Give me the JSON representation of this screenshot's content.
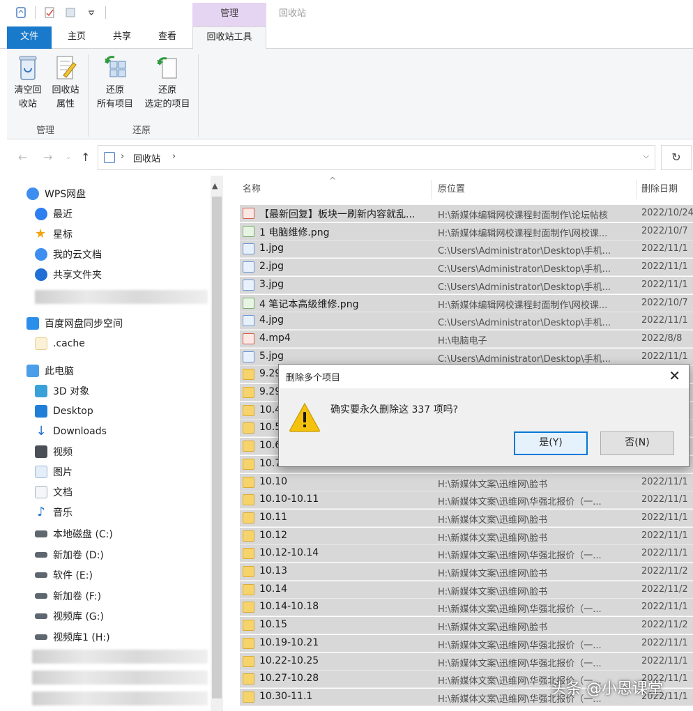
{
  "window": {
    "context_group_label": "管理",
    "title": "回收站"
  },
  "tabs": {
    "file": "文件",
    "home": "主页",
    "share": "共享",
    "view": "查看",
    "recycle_tools": "回收站工具"
  },
  "ribbon": {
    "empty_bin": "清空回\n收站",
    "bin_props": "回收站\n属性",
    "restore_all": "还原\n所有项目",
    "restore_selected": "还原\n选定的项目",
    "group_manage": "管理",
    "group_restore": "还原"
  },
  "address": {
    "location": "回收站"
  },
  "nav": {
    "wps": "WPS网盘",
    "recent": "最近",
    "starred": "星标",
    "my_cloud": "我的云文档",
    "shared": "共享文件夹",
    "baidu": "百度网盘同步空间",
    "cache": ".cache",
    "this_pc": "此电脑",
    "objects3d": "3D 对象",
    "desktop": "Desktop",
    "downloads": "Downloads",
    "videos": "视频",
    "pictures": "图片",
    "documents": "文档",
    "music": "音乐",
    "drive_c": "本地磁盘 (C:)",
    "drive_d": "新加卷 (D:)",
    "drive_e": "软件 (E:)",
    "drive_f": "新加卷 (F:)",
    "drive_g": "视频库 (G:)",
    "drive_h": "视频库1 (H:)"
  },
  "columns": {
    "name": "名称",
    "location": "原位置",
    "date": "删除日期"
  },
  "files": [
    {
      "name": "【最新回复】板块一刷新内容就乱...",
      "loc": "H:\\新媒体编辑网校课程封面制作\\论坛帖核",
      "date": "2022/10/24",
      "icon": "red"
    },
    {
      "name": "1 电脑维修.png",
      "loc": "H:\\新媒体编辑网校课程封面制作\\网校课...",
      "date": "2022/10/7",
      "icon": "imgg"
    },
    {
      "name": "1.jpg",
      "loc": "C:\\Users\\Administrator\\Desktop\\手机...",
      "date": "2022/11/1",
      "icon": "imgf"
    },
    {
      "name": "2.jpg",
      "loc": "C:\\Users\\Administrator\\Desktop\\手机...",
      "date": "2022/11/1",
      "icon": "imgf"
    },
    {
      "name": "3.jpg",
      "loc": "C:\\Users\\Administrator\\Desktop\\手机...",
      "date": "2022/11/1",
      "icon": "imgf"
    },
    {
      "name": "4 笔记本高级维修.png",
      "loc": "H:\\新媒体编辑网校课程封面制作\\网校课...",
      "date": "2022/10/7",
      "icon": "imgg"
    },
    {
      "name": "4.jpg",
      "loc": "C:\\Users\\Administrator\\Desktop\\手机...",
      "date": "2022/11/1",
      "icon": "imgf"
    },
    {
      "name": "4.mp4",
      "loc": "H:\\电脑电子",
      "date": "2022/8/8",
      "icon": "red"
    },
    {
      "name": "5.jpg",
      "loc": "C:\\Users\\Administrator\\Desktop\\手机...",
      "date": "2022/11/1",
      "icon": "imgf"
    },
    {
      "name": "9.29",
      "loc": "",
      "date": "",
      "icon": "folder"
    },
    {
      "name": "9.29",
      "loc": "",
      "date": "",
      "icon": "folder"
    },
    {
      "name": "10.4",
      "loc": "",
      "date": "",
      "icon": "folder"
    },
    {
      "name": "10.5",
      "loc": "",
      "date": "",
      "icon": "folder"
    },
    {
      "name": "10.6",
      "loc": "",
      "date": "",
      "icon": "folder"
    },
    {
      "name": "10.7",
      "loc": "",
      "date": "",
      "icon": "folder"
    },
    {
      "name": "10.10",
      "loc": "H:\\新媒体文案\\迅维网\\脸书",
      "date": "2022/11/1",
      "icon": "folder"
    },
    {
      "name": "10.10-10.11",
      "loc": "H:\\新媒体文案\\迅维网\\华强北报价（一...",
      "date": "2022/11/1",
      "icon": "folder"
    },
    {
      "name": "10.11",
      "loc": "H:\\新媒体文案\\迅维网\\脸书",
      "date": "2022/11/1",
      "icon": "folder"
    },
    {
      "name": "10.12",
      "loc": "H:\\新媒体文案\\迅维网\\脸书",
      "date": "2022/11/1",
      "icon": "folder"
    },
    {
      "name": "10.12-10.14",
      "loc": "H:\\新媒体文案\\迅维网\\华强北报价（一...",
      "date": "2022/11/1",
      "icon": "folder"
    },
    {
      "name": "10.13",
      "loc": "H:\\新媒体文案\\迅维网\\脸书",
      "date": "2022/11/2",
      "icon": "folder"
    },
    {
      "name": "10.14",
      "loc": "H:\\新媒体文案\\迅维网\\脸书",
      "date": "2022/11/2",
      "icon": "folder"
    },
    {
      "name": "10.14-10.18",
      "loc": "H:\\新媒体文案\\迅维网\\华强北报价（一...",
      "date": "2022/11/1",
      "icon": "folder"
    },
    {
      "name": "10.15",
      "loc": "H:\\新媒体文案\\迅维网\\脸书",
      "date": "2022/11/2",
      "icon": "folder"
    },
    {
      "name": "10.19-10.21",
      "loc": "H:\\新媒体文案\\迅维网\\华强北报价（一...",
      "date": "2022/11/1",
      "icon": "folder"
    },
    {
      "name": "10.22-10.25",
      "loc": "H:\\新媒体文案\\迅维网\\华强北报价（一...",
      "date": "2022/11/1",
      "icon": "folder"
    },
    {
      "name": "10.27-10.28",
      "loc": "H:\\新媒体文案\\迅维网\\华强北报价（一...",
      "date": "2022/11/1",
      "icon": "folder"
    },
    {
      "name": "10.30-11.1",
      "loc": "H:\\新媒体文案\\迅维网\\华强北报价（一...",
      "date": "2022/11/1",
      "icon": "folder"
    }
  ],
  "dialog": {
    "title": "删除多个项目",
    "message": "确实要永久删除这 337 项吗?",
    "yes": "是(Y)",
    "no": "否(N)"
  },
  "watermark": "头条 @小恩课堂",
  "colors": {
    "accent": "#1979ca",
    "context_tab": "#e6d5f2",
    "selected_row": "#d8d8d8",
    "warning": "#f4c20d"
  }
}
